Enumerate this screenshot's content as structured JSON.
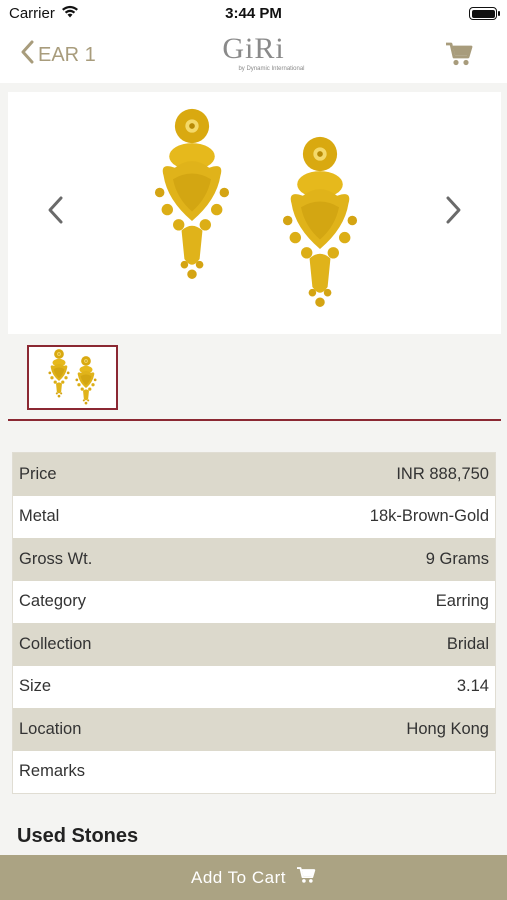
{
  "status": {
    "carrier": "Carrier",
    "time": "3:44 PM"
  },
  "nav": {
    "back_label": "EAR 1",
    "logo_text": "GiRi",
    "logo_tagline": "by Dynamic International"
  },
  "specs": [
    {
      "label": "Price",
      "value": "INR 888,750"
    },
    {
      "label": "Metal",
      "value": "18k-Brown-Gold"
    },
    {
      "label": "Gross Wt.",
      "value": "9 Grams"
    },
    {
      "label": "Category",
      "value": "Earring"
    },
    {
      "label": "Collection",
      "value": "Bridal"
    },
    {
      "label": "Size",
      "value": "3.14"
    },
    {
      "label": "Location",
      "value": "Hong Kong"
    },
    {
      "label": "Remarks",
      "value": ""
    }
  ],
  "stones_title": "Used Stones",
  "add_to_cart_label": "Add To Cart",
  "colors": {
    "accent": "#a89c7c",
    "button": "#aba383",
    "border_red": "#8b2833",
    "row_shade": "#dcd9cc",
    "gold": "#e0b51a"
  },
  "icons": [
    "wifi-icon",
    "battery-icon",
    "chevron-left-icon",
    "cart-icon",
    "chevron-right-icon"
  ]
}
